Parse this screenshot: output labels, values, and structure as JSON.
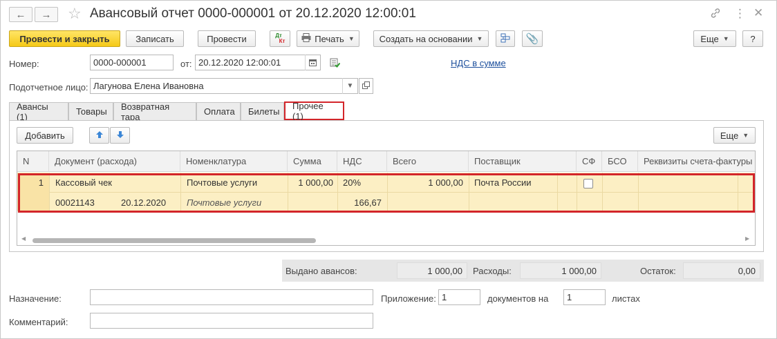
{
  "window": {
    "title": "Авансовый отчет 0000-000001 от 20.12.2020 12:00:01"
  },
  "toolbar": {
    "post_close": "Провести и закрыть",
    "save": "Записать",
    "post": "Провести",
    "dtkt_top": "Дт",
    "dtkt_bottom": "Кт",
    "print": "Печать",
    "create_based": "Создать на основании",
    "more": "Еще",
    "help": "?"
  },
  "header": {
    "number_label": "Номер:",
    "number_value": "0000-000001",
    "date_label": "от:",
    "date_value": "20.12.2020 12:00:01",
    "vat_link": "НДС в сумме",
    "person_label": "Подотчетное лицо:",
    "person_value": "Лагунова Елена Ивановна"
  },
  "tabs": [
    {
      "label": "Авансы (1)"
    },
    {
      "label": "Товары"
    },
    {
      "label": "Возвратная тара"
    },
    {
      "label": "Оплата"
    },
    {
      "label": "Билеты"
    },
    {
      "label": "Прочее (1)",
      "active": true
    }
  ],
  "panel_toolbar": {
    "add": "Добавить",
    "more": "Еще"
  },
  "table": {
    "columns": [
      "N",
      "Документ (расхода)",
      "Номенклатура",
      "Сумма",
      "НДС",
      "Всего",
      "Поставщик",
      "СФ",
      "БСО",
      "Реквизиты счета-фактуры"
    ],
    "rows": [
      {
        "n": "1",
        "doc_type": "Кассовый чек",
        "doc_number": "00021143",
        "doc_date": "20.12.2020",
        "nomenclature": "Почтовые услуги",
        "nomenclature_sub": "Почтовые услуги",
        "sum": "1 000,00",
        "vat_rate": "20%",
        "vat_amount": "166,67",
        "total": "1 000,00",
        "supplier": "Почта России",
        "sf": false
      }
    ]
  },
  "totals": {
    "issued_label": "Выдано авансов:",
    "issued_value": "1 000,00",
    "expenses_label": "Расходы:",
    "expenses_value": "1 000,00",
    "balance_label": "Остаток:",
    "balance_value": "0,00"
  },
  "footer": {
    "purpose_label": "Назначение:",
    "purpose_value": "",
    "attachment_label": "Приложение:",
    "attachment_value": "1",
    "docs_on_label": "документов на",
    "sheets_value": "1",
    "sheets_label": "листах",
    "comment_label": "Комментарий:",
    "comment_value": ""
  },
  "colors": {
    "primary_button": "#f5c917",
    "selected_row": "#fcefc4",
    "highlight_frame": "#d3252a",
    "link": "#1c4f9c"
  }
}
